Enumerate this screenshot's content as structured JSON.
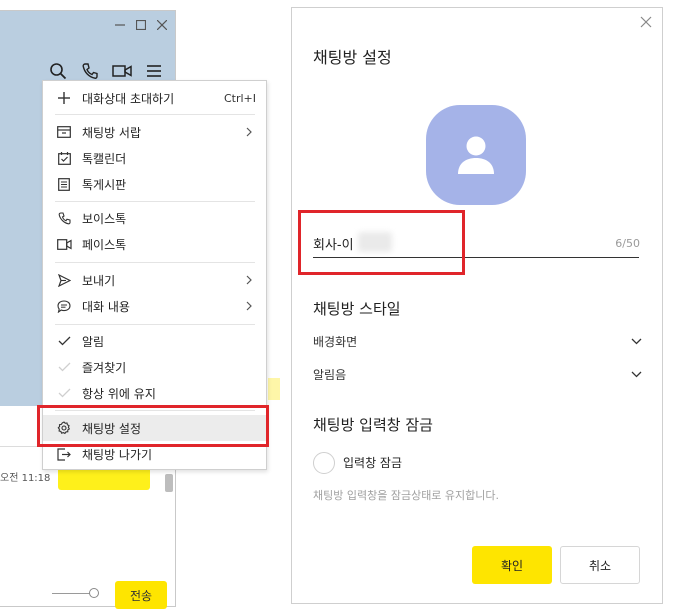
{
  "chat_window": {
    "message_time": "오전 11:18",
    "send_label": "전송"
  },
  "context_menu": {
    "items": [
      {
        "label": "대화상대 초대하기",
        "shortcut": "Ctrl+I",
        "icon": "plus-icon"
      },
      {
        "label": "채팅방 서랍",
        "icon": "drawer-icon",
        "submenu": true
      },
      {
        "label": "톡캘린더",
        "icon": "calendar-icon"
      },
      {
        "label": "톡게시판",
        "icon": "board-icon"
      },
      {
        "label": "보이스톡",
        "icon": "phone-icon"
      },
      {
        "label": "페이스톡",
        "icon": "video-icon"
      },
      {
        "label": "보내기",
        "icon": "send-icon",
        "submenu": true
      },
      {
        "label": "대화 내용",
        "icon": "chat-bubble-icon",
        "submenu": true
      },
      {
        "label": "알림",
        "icon": "check-icon",
        "checked": true
      },
      {
        "label": "즐겨찾기",
        "icon": "check-icon",
        "checked": false
      },
      {
        "label": "항상 위에 유지",
        "icon": "check-icon",
        "checked": false
      },
      {
        "label": "채팅방 설정",
        "icon": "gear-icon",
        "highlighted": true
      },
      {
        "label": "채팅방 나가기",
        "icon": "exit-icon"
      }
    ]
  },
  "settings": {
    "title": "채팅방 설정",
    "name_value": "회사-이",
    "name_count": "6/50",
    "style_title": "채팅방 스타일",
    "background_label": "배경화면",
    "sound_label": "알림음",
    "lock_title": "채팅방 입력창 잠금",
    "lock_label": "입력창 잠금",
    "lock_hint": "채팅방 입력창을 잠금상태로 유지합니다.",
    "confirm_label": "확인",
    "cancel_label": "취소"
  },
  "colors": {
    "chat_background": "#bacee0",
    "accent_yellow": "#fee500",
    "highlight_red": "#e0252a",
    "avatar": "#a5b3e8"
  }
}
